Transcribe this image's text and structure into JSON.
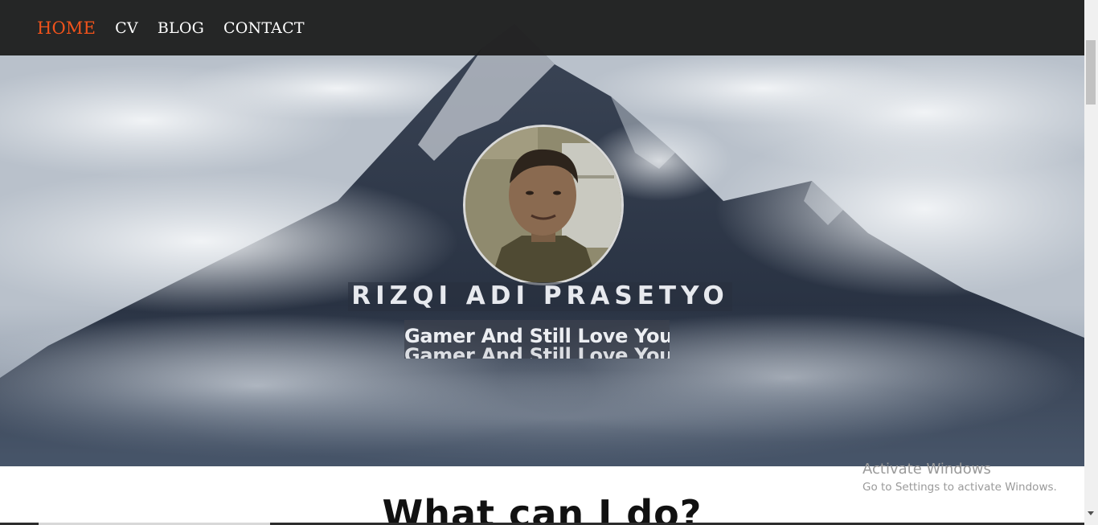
{
  "navbar": {
    "items": [
      {
        "label": "HOME",
        "active": true
      },
      {
        "label": "CV",
        "active": false
      },
      {
        "label": "BLOG",
        "active": false
      },
      {
        "label": "CONTACT",
        "active": false
      }
    ]
  },
  "hero": {
    "name": "RIZQI ADI PRASETYO",
    "tagline": "Gamer And Still Love You",
    "avatar_icon": "avatar-icon"
  },
  "section": {
    "title": "What can I do?"
  },
  "watermark": {
    "title": "Activate Windows",
    "subtitle": "Go to Settings to activate Windows."
  },
  "colors": {
    "nav_bg": "#1c1c1c",
    "nav_active": "#f2531b",
    "nav_text": "#ffffff"
  }
}
